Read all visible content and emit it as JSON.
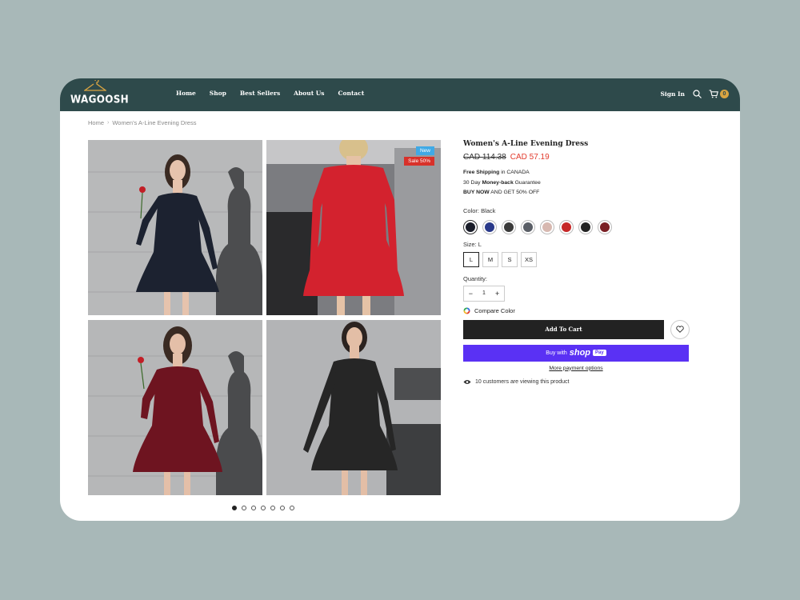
{
  "brand": {
    "logo_text": "WAGOOSH"
  },
  "nav": [
    "Home",
    "Shop",
    "Best Sellers",
    "About Us",
    "Contact"
  ],
  "header": {
    "sign_in": "Sign In",
    "cart_count": "0"
  },
  "breadcrumb": {
    "home": "Home",
    "current": "Women's A-Line Evening Dress"
  },
  "gallery": {
    "badge_new": "New",
    "badge_sale": "Sale 50%",
    "dots": 7,
    "active_dot": 0,
    "dress_colors": [
      "#1c2230",
      "#d3222e",
      "#6e1420",
      "#262626"
    ]
  },
  "product": {
    "title": "Women's A-Line Evening Dress",
    "old_price": "CAD 114.38",
    "new_price": "CAD 57.19",
    "shipping_bold": "Free Shipping",
    "shipping_rest": " in CANADA",
    "guarantee_pre": "30 Day ",
    "guarantee_bold": "Money-back",
    "guarantee_rest": " Guarantee",
    "offer_bold": "BUY NOW",
    "offer_rest": " AND GET 50% OFF",
    "color_label": "Color: ",
    "color_value": "Black",
    "size_label": "Size: ",
    "size_value": "L",
    "sizes": [
      "L",
      "M",
      "S",
      "XS"
    ],
    "quantity_label": "Quantity:",
    "quantity_value": "1",
    "compare_color": "Compare Color",
    "add_to_cart": "Add To Cart",
    "buy_with": "Buy with",
    "shop_brand": "shop",
    "pay_tag": "Pay",
    "more_payment": "More payment options",
    "viewing": "10 customers are viewing this product",
    "swatch_colors": [
      "#1a1d2a",
      "#2a3a8a",
      "#3a3a3a",
      "#5a5e66",
      "#d7b8b0",
      "#c62828",
      "#222222",
      "#7a1f24"
    ]
  },
  "colors": {
    "header_bg": "#2e4a4b",
    "accent_sale": "#e23a2c",
    "shop_pay": "#5a31f4",
    "badge_cart": "#d9a441"
  }
}
